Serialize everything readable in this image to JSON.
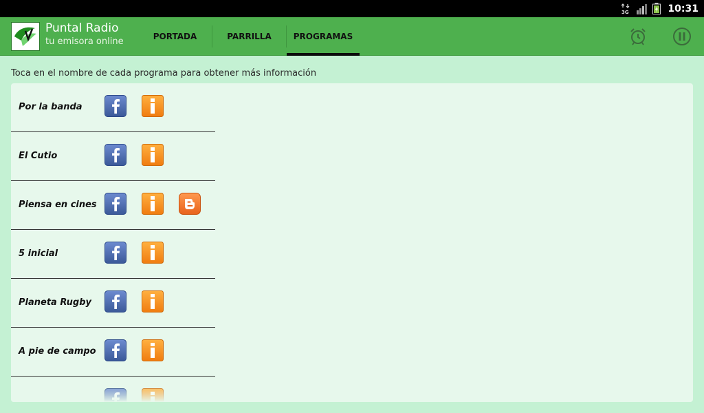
{
  "status_bar": {
    "network": "3G",
    "clock": "10:31"
  },
  "app": {
    "title": "Puntal Radio",
    "subtitle": "tu emisora online"
  },
  "tabs": [
    {
      "label": "PORTADA",
      "selected": false
    },
    {
      "label": "PARRILLA",
      "selected": false
    },
    {
      "label": "PROGRAMAS",
      "selected": true
    }
  ],
  "action_icons": [
    "alarm-clock-icon",
    "pause-icon"
  ],
  "hint": "Toca en el nombre de cada programa para obtener más información",
  "programs": [
    {
      "name": "Por la banda",
      "icons": [
        "facebook-icon",
        "info-icon"
      ]
    },
    {
      "name": "El Cutio",
      "icons": [
        "facebook-icon",
        "info-icon"
      ]
    },
    {
      "name": "Piensa en cines",
      "icons": [
        "facebook-icon",
        "info-icon",
        "blogger-icon"
      ]
    },
    {
      "name": "5 inicial",
      "icons": [
        "facebook-icon",
        "info-icon"
      ]
    },
    {
      "name": "Planeta Rugby",
      "icons": [
        "facebook-icon",
        "info-icon"
      ]
    },
    {
      "name": "A pie de campo",
      "icons": [
        "facebook-icon",
        "info-icon"
      ]
    },
    {
      "name": "",
      "icons": [
        "facebook-icon",
        "info-icon"
      ]
    }
  ],
  "colors": {
    "action_bar": "#4eb04e",
    "background": "#c4f1d3",
    "panel": "#e7f8ec",
    "facebook": "#3b5998",
    "info": "#f7941d",
    "blogger": "#f26c28"
  }
}
